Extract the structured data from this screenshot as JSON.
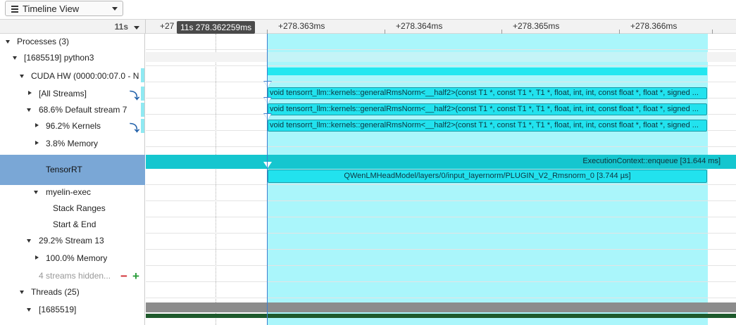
{
  "toolbar": {
    "view_label": "Timeline View"
  },
  "ruler": {
    "zoom_label": "11s",
    "cursor_tooltip": "11s 278.362259ms",
    "ticks": [
      "+27",
      "+278.363ms",
      "+278.364ms",
      "+278.365ms",
      "+278.366ms"
    ]
  },
  "tree": {
    "processes": "Processes (3)",
    "process_python": "[1685519] python3",
    "cuda_hw": "CUDA HW (0000:00:07.0 - N",
    "all_streams": "[All Streams]",
    "default_stream": "68.6% Default stream 7",
    "kernels": "96.2% Kernels",
    "memory_38": "3.8% Memory",
    "tensorrt": "TensorRT",
    "myelin": "myelin-exec",
    "stack_ranges": "Stack Ranges",
    "start_end": "Start & End",
    "stream13": "29.2% Stream 13",
    "memory_100": "100.0% Memory",
    "hidden": "4 streams hidden...",
    "threads": "Threads (25)",
    "thread_1685519": "[1685519]"
  },
  "timeline": {
    "kernel_label": "void tensorrt_llm::kernels::generalRmsNorm<__half2>(const T1 *, const T1 *, T1 *, float, int, int, const float *, float *, signed ...",
    "enqueue_label": "ExecutionContext::enqueue [31.644 ms]",
    "plugin_label": "QWenLMHeadModel/layers/0/input_layernorm/PLUGIN_V2_Rmsnorm_0 [3.744 µs]"
  },
  "colors": {
    "selection": "#aaf6fb",
    "kernel": "#22e2ee",
    "tensorrt_row": "#7aa7d6",
    "thread_bar": "#8c8c8c",
    "thread_green": "#1e5a2c"
  }
}
